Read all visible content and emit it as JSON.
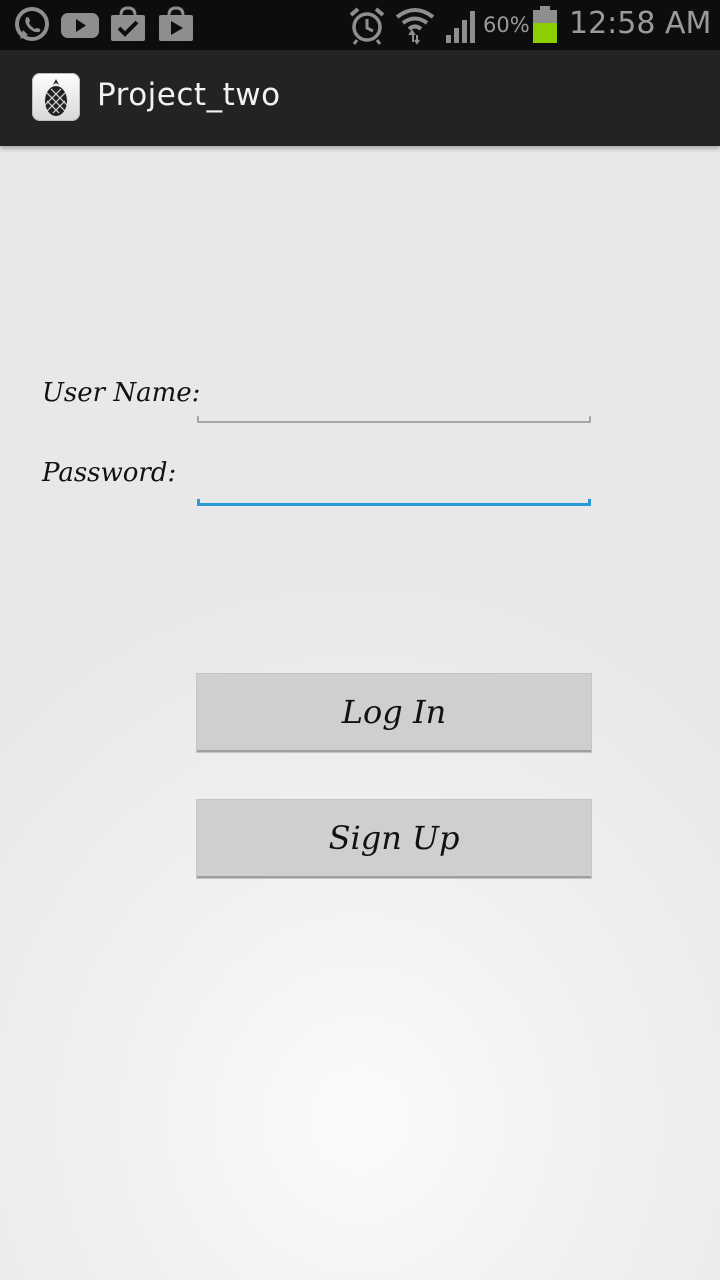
{
  "status_bar": {
    "icons_left": [
      "whatsapp-icon",
      "youtube-icon",
      "check-bag-icon",
      "play-store-icon"
    ],
    "icons_right": [
      "alarm-icon",
      "wifi-icon",
      "signal-icon",
      "battery-icon"
    ],
    "battery_percent": "60%",
    "time": "12:58 AM",
    "battery_color": "#8ccf00"
  },
  "action_bar": {
    "title": "Project_two",
    "icon": "pineapple-app-icon"
  },
  "form": {
    "username_label": "User Name:",
    "username_value": "",
    "password_label": "Password:",
    "password_value": "",
    "focus_color": "#2a9ad4"
  },
  "buttons": {
    "login_label": "Log In",
    "signup_label": "Sign Up"
  }
}
